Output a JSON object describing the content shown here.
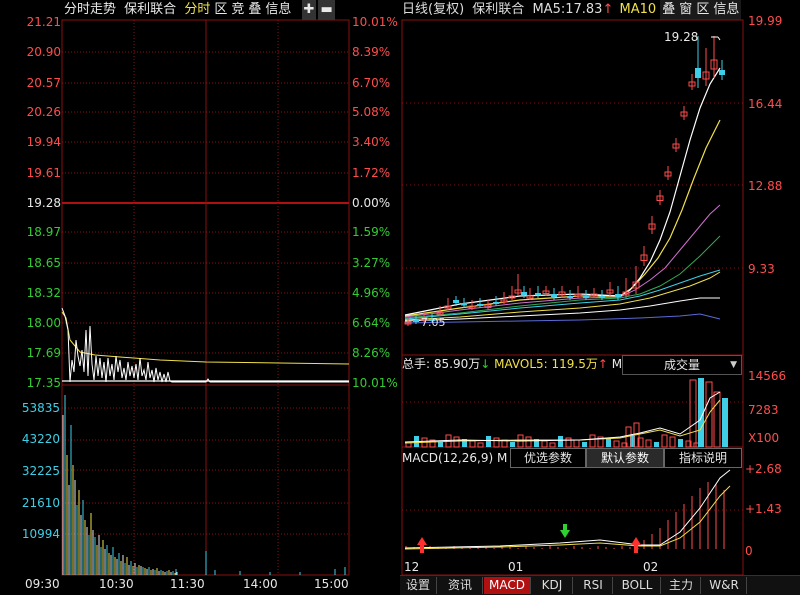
{
  "left_header": {
    "title": "分时走势",
    "stock": "保利联合",
    "buttons": [
      "分时",
      "区",
      "竞",
      "叠",
      "信息"
    ],
    "plus": "✚",
    "minus": "▬"
  },
  "left_price_axis": [
    "21.21",
    "20.90",
    "20.57",
    "20.26",
    "19.94",
    "19.61",
    "19.28",
    "18.97",
    "18.65",
    "18.32",
    "18.00",
    "17.69",
    "17.35"
  ],
  "left_pct_axis": [
    "10.01%",
    "8.39%",
    "6.70%",
    "5.08%",
    "3.40%",
    "1.72%",
    "0.00%",
    "1.59%",
    "3.27%",
    "4.96%",
    "6.64%",
    "8.26%",
    "10.01%"
  ],
  "left_volume_axis": [
    "53835",
    "43220",
    "32225",
    "21610",
    "10994"
  ],
  "left_time_axis": [
    "09:30",
    "10:30",
    "11:30",
    "14:00",
    "15:00"
  ],
  "right_header": {
    "period": "日线(复权)",
    "stock": "保利联合",
    "ma5_label": "MA5:",
    "ma5_value": "17.83",
    "ma5_arrow": "↑",
    "ma10_label": "MA10",
    "buttons": [
      "叠",
      "窗",
      "区",
      "信息"
    ]
  },
  "right_price_axis": [
    "19.99",
    "16.44",
    "12.88",
    "9.33"
  ],
  "high_label": "19.28",
  "low_label": "7.05",
  "volume_panel": {
    "total_label": "总手: 85.90万",
    "total_arrow": "↓",
    "mavol_label": "MAVOL5: 119.5万",
    "mavol_arrow": "↑",
    "extra": "M",
    "dropdown": "成交量",
    "dropdown_arrow": "▼",
    "axis": [
      "14566",
      "7283",
      "X100"
    ]
  },
  "macd_panel": {
    "label": "MACD(12,26,9)",
    "extra": "M",
    "buttons": [
      "优选参数",
      "默认参数",
      "指标说明"
    ],
    "axis": [
      "+2.68",
      "+1.43",
      "0"
    ]
  },
  "right_time_axis": [
    "12",
    "01",
    "02"
  ],
  "tabs": [
    "设置",
    "资讯",
    "MACD",
    "KDJ",
    "RSI",
    "BOLL",
    "主力",
    "W&R"
  ],
  "active_tab": "MACD",
  "colors": {
    "up": "#ff4d4d",
    "down": "#33cc33",
    "grid": "#8a1010",
    "price_line": "#ffffff",
    "avg_line": "#f0e04a",
    "volume": "#3ecfe6"
  }
}
